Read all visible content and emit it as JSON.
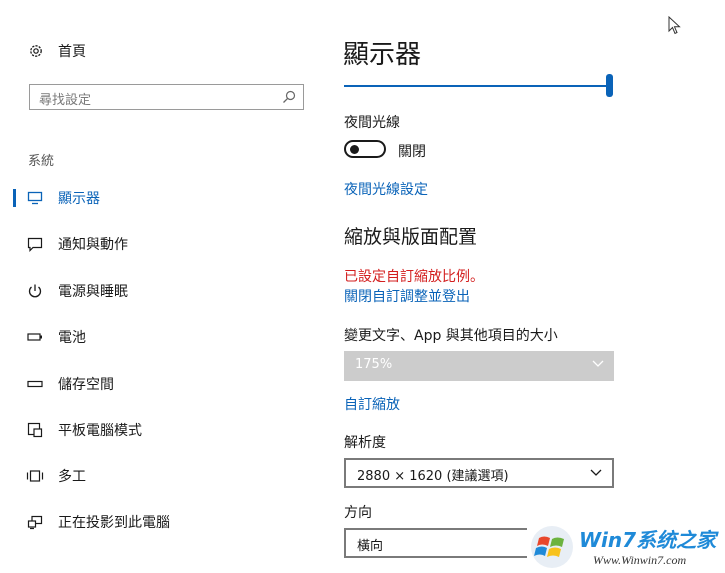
{
  "sidebar": {
    "home_label": "首頁",
    "search_placeholder": "尋找設定",
    "section_label": "系統",
    "items": [
      {
        "label": "顯示器",
        "icon": "monitor-icon"
      },
      {
        "label": "通知與動作",
        "icon": "notification-icon"
      },
      {
        "label": "電源與睡眠",
        "icon": "power-icon"
      },
      {
        "label": "電池",
        "icon": "battery-icon"
      },
      {
        "label": "儲存空間",
        "icon": "storage-icon"
      },
      {
        "label": "平板電腦模式",
        "icon": "tablet-mode-icon"
      },
      {
        "label": "多工",
        "icon": "multitasking-icon"
      },
      {
        "label": "正在投影到此電腦",
        "icon": "projecting-icon"
      }
    ]
  },
  "main": {
    "title": "顯示器",
    "brightness_level": 1.0,
    "night_light_label": "夜間光線",
    "night_light_state": "關閉",
    "night_light_settings_link": "夜間光線設定",
    "scale_layout_heading": "縮放與版面配置",
    "custom_scale_warning": "已設定自訂縮放比例。",
    "custom_scale_off_link": "關閉自訂調整並登出",
    "text_size_label": "變更文字、App 與其他項目的大小",
    "scale_value": "175%",
    "custom_scale_link": "自訂縮放",
    "resolution_label": "解析度",
    "resolution_value": "2880 × 1620 (建議選項)",
    "orientation_label": "方向",
    "orientation_value": "橫向"
  },
  "watermark": {
    "brand": "Win7系统之家",
    "url": "Www.Winwin7.com"
  },
  "colors": {
    "accent": "#0a63b8",
    "warning": "#d31f1f"
  }
}
